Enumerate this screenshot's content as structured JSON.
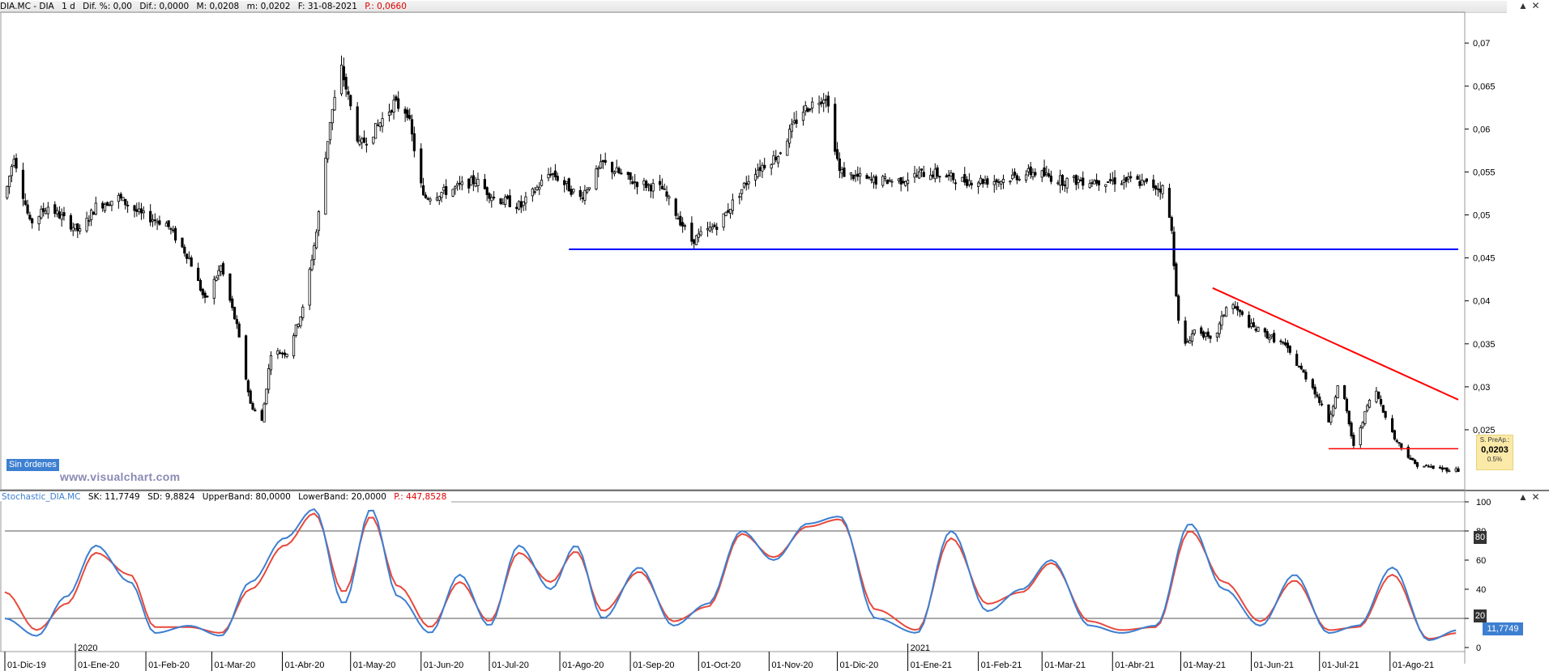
{
  "header": {
    "symbol": "DIA.MC - DIA",
    "interval": "1 d",
    "dif_pct": "Dif. %: 0,00",
    "dif": "Dif.: 0,0000",
    "max": "M: 0,0208",
    "min": "m: 0,0202",
    "date": "F: 31-08-2021",
    "p": "P.: 0,0660"
  },
  "window_controls": {
    "up": "▲",
    "close": "✕"
  },
  "indicator_header": {
    "name": "Stochastic_DIA.MC",
    "sk": "SK: 11,7749",
    "sd": "SD: 9,8824",
    "upper": "UpperBand: 80,0000",
    "lower": "LowerBand: 20,0000",
    "p": "P.: 447,8528"
  },
  "orders_badge": "Sin órdenes",
  "watermark": "www.visualchart.com",
  "price_tag": {
    "title": "S. PreAp.:",
    "value": "0,0203",
    "pct": "0.5%"
  },
  "price_axis_ticks": [
    "0,07",
    "0,065",
    "0,06",
    "0,055",
    "0,05",
    "0,045",
    "0,04",
    "0,035",
    "0,03",
    "0,025"
  ],
  "stoch_axis_ticks": [
    "100",
    "80",
    "60",
    "40",
    "20",
    "0"
  ],
  "band_labels": {
    "upper": "80",
    "lower": "20"
  },
  "sk_value": "11,7749",
  "date_axis": [
    {
      "label": "01-Dic-19"
    },
    {
      "label": "01-Ene-20"
    },
    {
      "label": "01-Feb-20"
    },
    {
      "label": "01-Mar-20"
    },
    {
      "label": "01-Abr-20"
    },
    {
      "label": "01-May-20"
    },
    {
      "label": "01-Jun-20"
    },
    {
      "label": "01-Jul-20"
    },
    {
      "label": "01-Ago-20"
    },
    {
      "label": "01-Sep-20"
    },
    {
      "label": "01-Oct-20"
    },
    {
      "label": "01-Nov-20"
    },
    {
      "label": "01-Dic-20"
    },
    {
      "label": "01-Ene-21"
    },
    {
      "label": "01-Feb-21"
    },
    {
      "label": "01-Mar-21"
    },
    {
      "label": "01-Abr-21"
    },
    {
      "label": "01-May-21"
    },
    {
      "label": "01-Jun-21"
    },
    {
      "label": "01-Jul-21"
    },
    {
      "label": "01-Ago-21"
    }
  ],
  "year_labels": [
    "2020",
    "2021"
  ],
  "colors": {
    "candle": "#000000",
    "support": "#0000ff",
    "trend": "#ff0000",
    "sk": "#3d7fd0",
    "sd": "#e8483b"
  },
  "chart_data": [
    {
      "type": "candlestick",
      "title": "DIA.MC - DIA",
      "ylim": [
        0.0185,
        0.0735
      ],
      "x_start": "2019-12-01",
      "x_end": "2021-08-31",
      "close_series": [
        [
          "2019-12-01",
          0.052
        ],
        [
          "2019-12-05",
          0.057
        ],
        [
          "2019-12-12",
          0.049
        ],
        [
          "2019-12-20",
          0.051
        ],
        [
          "2020-01-03",
          0.048
        ],
        [
          "2020-01-10",
          0.051
        ],
        [
          "2020-01-20",
          0.052
        ],
        [
          "2020-01-30",
          0.05
        ],
        [
          "2020-02-10",
          0.049
        ],
        [
          "2020-02-20",
          0.045
        ],
        [
          "2020-02-27",
          0.04
        ],
        [
          "2020-03-05",
          0.044
        ],
        [
          "2020-03-12",
          0.037
        ],
        [
          "2020-03-18",
          0.028
        ],
        [
          "2020-03-23",
          0.026
        ],
        [
          "2020-03-27",
          0.034
        ],
        [
          "2020-04-03",
          0.034
        ],
        [
          "2020-04-10",
          0.039
        ],
        [
          "2020-04-16",
          0.048
        ],
        [
          "2020-04-22",
          0.061
        ],
        [
          "2020-04-27",
          0.067
        ],
        [
          "2020-05-05",
          0.058
        ],
        [
          "2020-05-12",
          0.06
        ],
        [
          "2020-05-20",
          0.063
        ],
        [
          "2020-05-26",
          0.062
        ],
        [
          "2020-06-02",
          0.052
        ],
        [
          "2020-06-15",
          0.053
        ],
        [
          "2020-06-25",
          0.054
        ],
        [
          "2020-07-03",
          0.052
        ],
        [
          "2020-07-15",
          0.051
        ],
        [
          "2020-07-28",
          0.055
        ],
        [
          "2020-08-10",
          0.052
        ],
        [
          "2020-08-20",
          0.056
        ],
        [
          "2020-09-01",
          0.054
        ],
        [
          "2020-09-15",
          0.053
        ],
        [
          "2020-09-28",
          0.047
        ],
        [
          "2020-10-10",
          0.049
        ],
        [
          "2020-10-25",
          0.055
        ],
        [
          "2020-11-05",
          0.057
        ],
        [
          "2020-11-15",
          0.062
        ],
        [
          "2020-11-26",
          0.064
        ],
        [
          "2020-12-02",
          0.055
        ],
        [
          "2020-12-15",
          0.054
        ],
        [
          "2020-12-28",
          0.054
        ],
        [
          "2021-01-10",
          0.055
        ],
        [
          "2021-01-25",
          0.054
        ],
        [
          "2021-02-10",
          0.054
        ],
        [
          "2021-02-25",
          0.055
        ],
        [
          "2021-03-10",
          0.054
        ],
        [
          "2021-03-25",
          0.054
        ],
        [
          "2021-04-10",
          0.054
        ],
        [
          "2021-04-24",
          0.053
        ],
        [
          "2021-04-27",
          0.048
        ],
        [
          "2021-05-01",
          0.034
        ],
        [
          "2021-05-08",
          0.037
        ],
        [
          "2021-05-15",
          0.035
        ],
        [
          "2021-05-22",
          0.04
        ],
        [
          "2021-06-01",
          0.037
        ],
        [
          "2021-06-15",
          0.035
        ],
        [
          "2021-06-28",
          0.03
        ],
        [
          "2021-07-05",
          0.026
        ],
        [
          "2021-07-10",
          0.031
        ],
        [
          "2021-07-16",
          0.023
        ],
        [
          "2021-07-25",
          0.03
        ],
        [
          "2021-08-03",
          0.024
        ],
        [
          "2021-08-12",
          0.021
        ],
        [
          "2021-08-22",
          0.0205
        ],
        [
          "2021-08-31",
          0.0203
        ]
      ],
      "support_line": {
        "y": 0.046,
        "x_from": "2020-08-05",
        "x_to": "2021-08-31"
      },
      "trend_line": {
        "from": [
          "2021-05-15",
          0.0415
        ],
        "to": [
          "2021-08-31",
          0.0285
        ]
      },
      "horizontal_line": {
        "y": 0.0228,
        "x_from": "2021-07-05",
        "x_to": "2021-08-31"
      }
    },
    {
      "type": "line",
      "title": "Stochastic_DIA.MC",
      "ylim": [
        0,
        100
      ],
      "bands": [
        80,
        20
      ],
      "series": [
        {
          "name": "SK",
          "x": [
            "2019-12-01",
            "2019-12-15",
            "2019-12-28",
            "2020-01-10",
            "2020-01-25",
            "2020-02-05",
            "2020-02-20",
            "2020-03-05",
            "2020-03-18",
            "2020-04-02",
            "2020-04-15",
            "2020-04-28",
            "2020-05-10",
            "2020-05-22",
            "2020-06-05",
            "2020-06-18",
            "2020-07-01",
            "2020-07-14",
            "2020-07-28",
            "2020-08-08",
            "2020-08-20",
            "2020-09-05",
            "2020-09-20",
            "2020-10-05",
            "2020-10-20",
            "2020-11-03",
            "2020-11-18",
            "2020-12-02",
            "2020-12-18",
            "2021-01-05",
            "2021-01-20",
            "2021-02-05",
            "2021-02-20",
            "2021-03-05",
            "2021-03-22",
            "2021-04-05",
            "2021-04-20",
            "2021-05-05",
            "2021-05-20",
            "2021-06-05",
            "2021-06-20",
            "2021-07-05",
            "2021-07-18",
            "2021-08-02",
            "2021-08-18",
            "2021-08-31"
          ],
          "values": [
            20,
            8,
            35,
            70,
            45,
            10,
            15,
            8,
            45,
            75,
            95,
            30,
            95,
            35,
            10,
            50,
            15,
            70,
            40,
            70,
            20,
            55,
            15,
            30,
            80,
            60,
            85,
            90,
            20,
            10,
            80,
            25,
            40,
            60,
            15,
            10,
            15,
            85,
            40,
            15,
            50,
            10,
            15,
            55,
            5,
            12
          ]
        },
        {
          "name": "SD",
          "x": [
            "2019-12-01",
            "2019-12-15",
            "2019-12-28",
            "2020-01-10",
            "2020-01-25",
            "2020-02-05",
            "2020-02-20",
            "2020-03-05",
            "2020-03-18",
            "2020-04-02",
            "2020-04-15",
            "2020-04-28",
            "2020-05-10",
            "2020-05-22",
            "2020-06-05",
            "2020-06-18",
            "2020-07-01",
            "2020-07-14",
            "2020-07-28",
            "2020-08-08",
            "2020-08-20",
            "2020-09-05",
            "2020-09-20",
            "2020-10-05",
            "2020-10-20",
            "2020-11-03",
            "2020-11-18",
            "2020-12-02",
            "2020-12-18",
            "2021-01-05",
            "2021-01-20",
            "2021-02-05",
            "2021-02-20",
            "2021-03-05",
            "2021-03-22",
            "2021-04-05",
            "2021-04-20",
            "2021-05-05",
            "2021-05-20",
            "2021-06-05",
            "2021-06-20",
            "2021-07-05",
            "2021-07-18",
            "2021-08-02",
            "2021-08-18",
            "2021-08-31"
          ],
          "values": [
            38,
            12,
            30,
            65,
            50,
            14,
            14,
            10,
            40,
            70,
            92,
            38,
            90,
            42,
            14,
            45,
            18,
            65,
            45,
            66,
            25,
            52,
            18,
            28,
            78,
            62,
            83,
            88,
            26,
            12,
            75,
            30,
            38,
            58,
            18,
            12,
            14,
            80,
            45,
            18,
            46,
            12,
            14,
            50,
            6,
            10
          ]
        }
      ]
    }
  ]
}
